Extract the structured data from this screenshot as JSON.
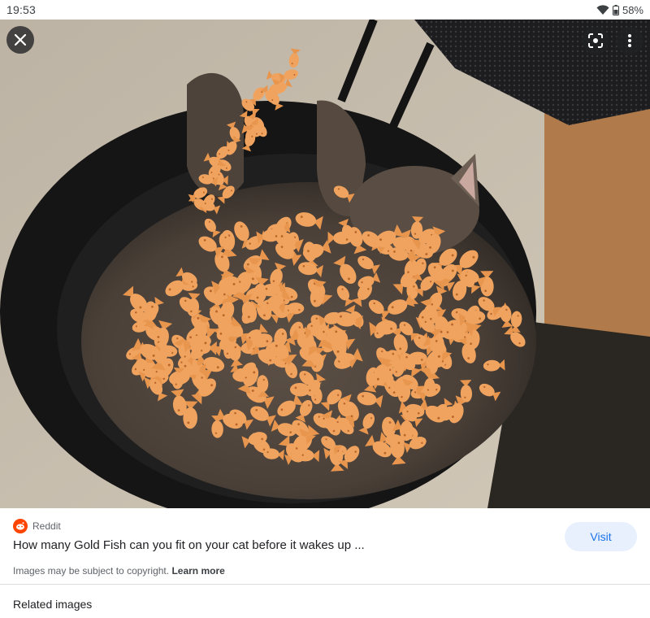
{
  "status_bar": {
    "time": "19:53",
    "battery": "58%"
  },
  "viewer": {
    "image_alt": "Cat sleeping on a chair covered in Goldfish crackers",
    "close_icon": "close-icon",
    "lens_icon": "lens-icon",
    "more_icon": "more-vert-icon"
  },
  "result": {
    "source": "Reddit",
    "source_icon": "reddit-icon",
    "title": "How many Gold Fish can you fit on your cat before it wakes up ...",
    "visit_label": "Visit",
    "copyright_text": "Images may be subject to copyright.",
    "learn_more_label": "Learn more",
    "related_label": "Related images"
  },
  "colors": {
    "visit_bg": "#e8f0fe",
    "visit_text": "#1a73e8",
    "reddit": "#ff4500"
  }
}
